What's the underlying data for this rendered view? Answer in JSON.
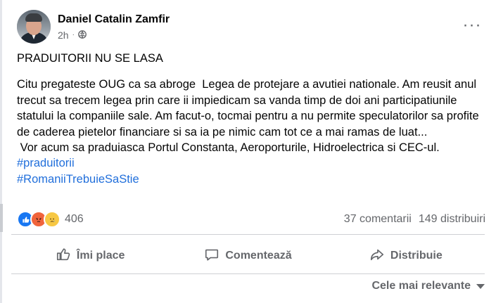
{
  "post": {
    "author": "Daniel Catalin Zamfir",
    "time": "2h",
    "time_separator": "·",
    "title": "PRADUITORII NU SE LASA",
    "paragraphs": [
      "Citu pregateste OUG ca sa abroge  Legea de protejare a avutiei nationale. Am reusit anul trecut sa trecem legea prin care ii impiedicam sa vanda timp de doi ani participatiunile statului la companiile sale. Am facut-o, tocmai pentru a nu permite speculatorilor sa profite de caderea pietelor financiare si sa ia pe nimic cam tot ce a mai ramas de luat...",
      " Vor acum sa praduiasca Portul Constanta, Aeroporturile, Hidroelectrica si CEC-ul."
    ],
    "hashtags": [
      "#praduitorii",
      "#RomaniiTrebuieSaStie"
    ],
    "more_icon": "···"
  },
  "engagement": {
    "reaction_count": "406",
    "comments": "37 comentarii",
    "shares": "149 distribuiri",
    "reaction_icons": [
      "like",
      "angry",
      "sad"
    ]
  },
  "actions": {
    "like": "Îmi place",
    "comment": "Comentează",
    "share": "Distribuie"
  },
  "sort": {
    "label": "Cele mai relevante"
  },
  "colors": {
    "link": "#216fdb",
    "muted": "#65676b",
    "like": "#1877f2"
  }
}
